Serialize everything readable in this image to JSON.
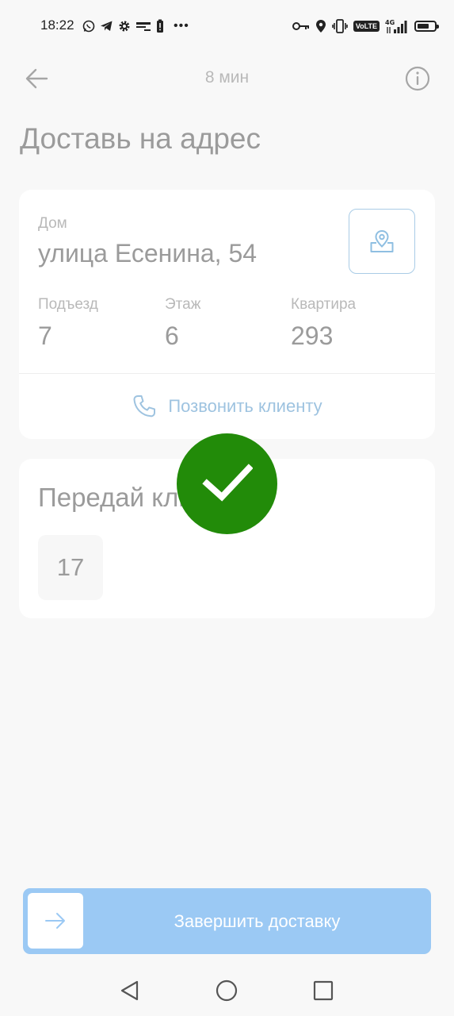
{
  "status_bar": {
    "time": "18:22",
    "left_icons": [
      "whatsapp-icon",
      "telegram-icon",
      "settings-icon",
      "app-icon",
      "battery-alert-icon",
      "more-dots-icon"
    ],
    "right_icons": [
      "key-icon",
      "location-icon",
      "vibrate-icon",
      "volte-icon",
      "4g-signal-icon",
      "battery-icon"
    ],
    "volte": "VoLTE",
    "network": "4G",
    "dots": "•••"
  },
  "top_bar": {
    "timer": "8 мин"
  },
  "page": {
    "title": "Доставь на адрес"
  },
  "address": {
    "house_label": "Дом",
    "street": "улица Есенина, 54",
    "entrance_label": "Подъезд",
    "entrance": "7",
    "floor_label": "Этаж",
    "floor": "6",
    "apartment_label": "Квартира",
    "apartment": "293",
    "call_label": "Позвонить клиенту"
  },
  "code_card": {
    "title": "Передай клиенту",
    "code": "17"
  },
  "finish": {
    "label": "Завершить доставку"
  },
  "colors": {
    "background": "#f8f8f8",
    "accent_blue": "#9bc9f4",
    "link_blue": "#9ec3e0",
    "success_green": "#228b09",
    "text_gray": "#9b9b9b",
    "label_gray": "#b9b9b9"
  }
}
